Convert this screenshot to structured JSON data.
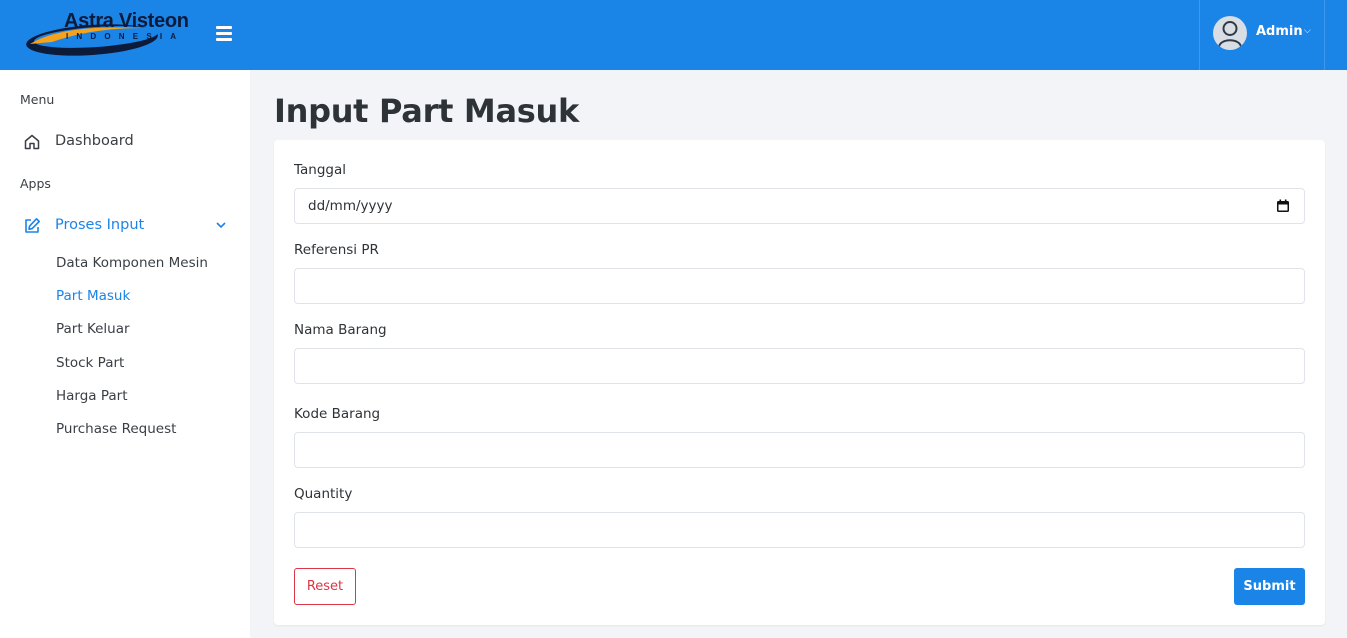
{
  "header": {
    "logo_title": "Astra Visteon",
    "logo_subtitle": "INDONESIA",
    "menu_icon": "hamburger-icon",
    "user": {
      "name": "Admin",
      "avatar_icon": "user-icon",
      "caret_icon": "chevron-down-icon"
    }
  },
  "sidebar": {
    "menu_heading": "Menu",
    "dashboard": {
      "label": "Dashboard",
      "icon": "home-icon"
    },
    "apps_heading": "Apps",
    "proses_input": {
      "label": "Proses Input",
      "icon": "edit-icon",
      "chevron": "chevron-down-icon"
    },
    "sub_items": [
      {
        "label": "Data Komponen Mesin"
      },
      {
        "label": "Part Masuk"
      },
      {
        "label": "Part Keluar"
      },
      {
        "label": "Stock Part"
      },
      {
        "label": "Harga Part"
      },
      {
        "label": "Purchase Request"
      }
    ]
  },
  "main": {
    "title": "Input Part Masuk",
    "form": {
      "tanggal": {
        "label": "Tanggal",
        "placeholder": "dd/mm/yyyy",
        "icon": "calendar-icon"
      },
      "referensi_pr": {
        "label": "Referensi PR",
        "value": ""
      },
      "nama_barang": {
        "label": "Nama Barang",
        "value": ""
      },
      "kode_barang": {
        "label": "Kode Barang",
        "value": ""
      },
      "quantity": {
        "label": "Quantity",
        "value": ""
      },
      "reset_label": "Reset",
      "submit_label": "Submit"
    }
  },
  "colors": {
    "primary": "#1b84e7",
    "danger": "#dc3545",
    "sidebar_bg": "#ffffff",
    "page_bg": "#f3f4f7"
  }
}
